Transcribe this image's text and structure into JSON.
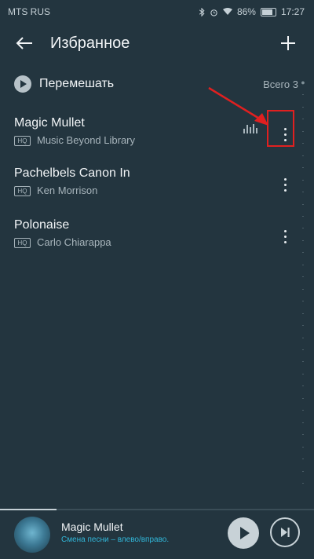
{
  "status_bar": {
    "carrier": "MTS RUS",
    "battery": "86%",
    "time": "17:27"
  },
  "header": {
    "title": "Избранное"
  },
  "shuffle": {
    "label": "Перемешать",
    "total": "Всего 3"
  },
  "songs": [
    {
      "title": "Magic Mullet",
      "artist": "Music Beyond Library",
      "badge": "HQ"
    },
    {
      "title": "Pachelbels Canon In",
      "artist": "Ken Morrison",
      "badge": "HQ"
    },
    {
      "title": "Polonaise",
      "artist": "Carlo Chiarappa",
      "badge": "HQ"
    }
  ],
  "now_playing": {
    "title": "Magic Mullet",
    "hint": "Смена песни – влево/вправо."
  },
  "accent_color": "#31b6d8",
  "annotation_color": "#e02020"
}
